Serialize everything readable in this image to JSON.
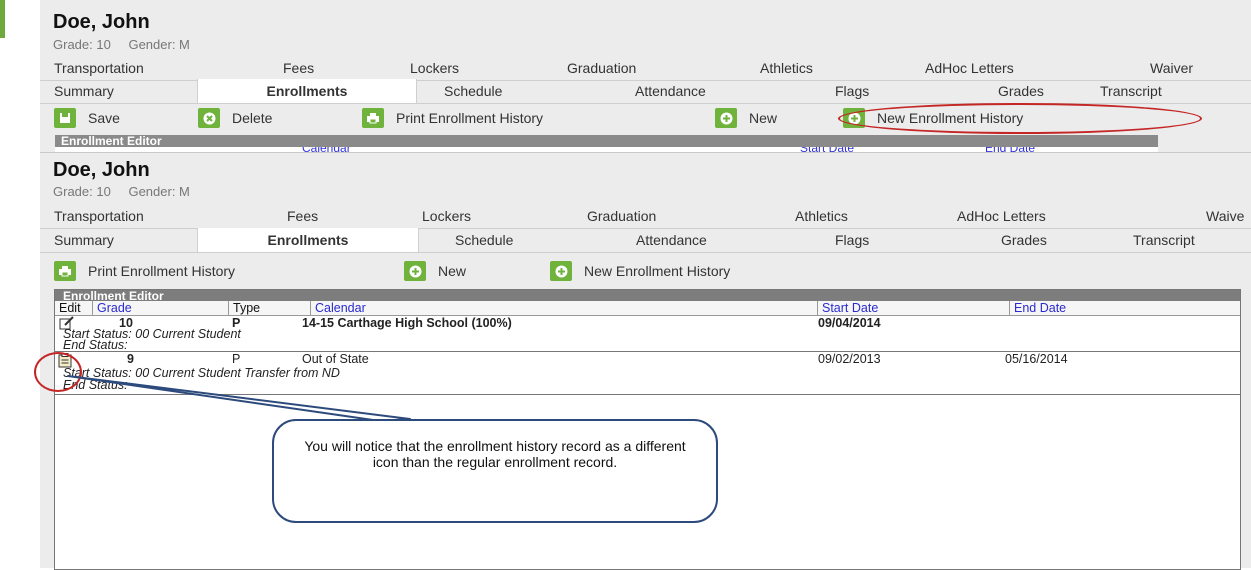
{
  "student": {
    "name": "Doe, John",
    "grade_label": "Grade: 10",
    "gender_label": "Gender: M"
  },
  "tabs_top_row": [
    "Transportation",
    "Fees",
    "Lockers",
    "Graduation",
    "Athletics",
    "AdHoc Letters",
    "Waiver"
  ],
  "tabs_second_row": [
    "Summary",
    "Enrollments",
    "Schedule",
    "Attendance",
    "Flags",
    "Grades",
    "Transcript"
  ],
  "tabs_top_row_lower": [
    "Transportation",
    "Fees",
    "Lockers",
    "Graduation",
    "Athletics",
    "AdHoc Letters",
    "Waive"
  ],
  "toolbar_top": {
    "save": "Save",
    "delete": "Delete",
    "print_history": "Print Enrollment History",
    "new": "New",
    "new_history": "New Enrollment History"
  },
  "toolbar_bottom": {
    "print_history": "Print Enrollment History",
    "new": "New",
    "new_history": "New Enrollment History"
  },
  "editor": {
    "title": "Enrollment Editor",
    "columns": {
      "edit": "Edit",
      "grade": "Grade",
      "type": "Type",
      "calendar": "Calendar",
      "start_date": "Start Date",
      "end_date": "End Date"
    },
    "rows": [
      {
        "grade": "10",
        "type": "P",
        "calendar": "14-15 Carthage High School (100%)",
        "start_date": "09/04/2014",
        "end_date": "",
        "start_status": "Start Status: 00 Current Student",
        "end_status": "End Status:",
        "icon": "edit-pencil-icon"
      },
      {
        "grade": "9",
        "type": "P",
        "calendar": "Out of State",
        "start_date": "09/02/2013",
        "end_date": "05/16/2014",
        "start_status": "Start Status: 00 Current Student Transfer from ND",
        "end_status": "End Status:",
        "icon": "clipboard-icon"
      }
    ]
  },
  "callout_text": "You will notice that the enrollment history record as a different icon than the regular enrollment record.",
  "colors": {
    "accent_green": "#6fb23c",
    "highlight_red": "#c42525",
    "link_blue": "#2a2ad0",
    "callout_border": "#2d4a7c"
  }
}
